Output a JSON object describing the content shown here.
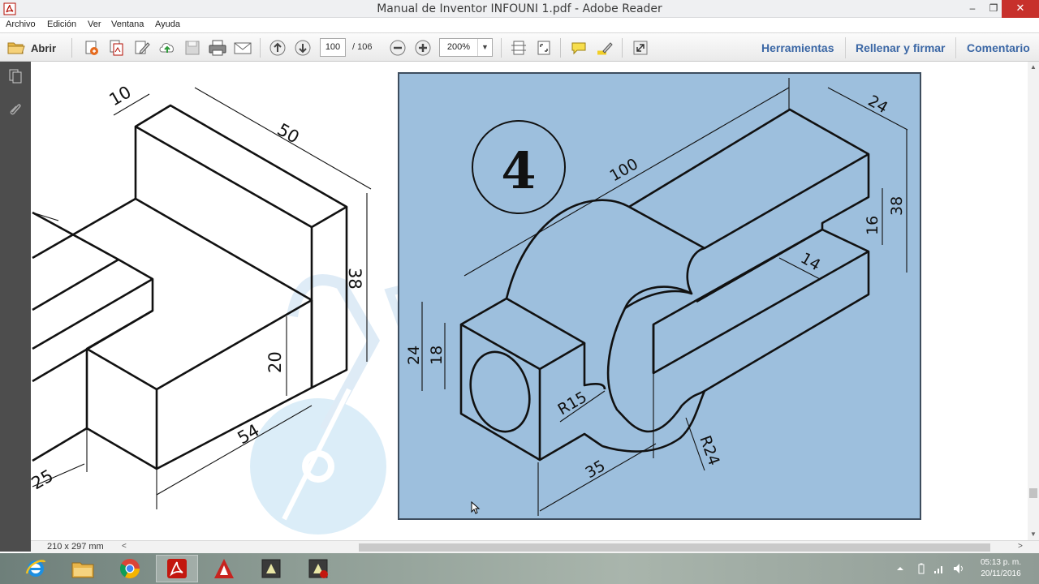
{
  "window": {
    "title": "Manual de Inventor INFOUNI 1.pdf - Adobe Reader",
    "minimize": "‒",
    "restore": "❐",
    "close": "✕"
  },
  "menu": [
    "Archivo",
    "Edición",
    "Ver",
    "Ventana",
    "Ayuda"
  ],
  "toolbar": {
    "open_label": "Abrir",
    "current_page": "100",
    "total_pages": "/ 106",
    "zoom": "200%",
    "zoom_arrow": "▼",
    "tools_label": "Herramientas",
    "fill_sign_label": "Rellenar y firmar",
    "comment_label": "Comentario"
  },
  "document": {
    "left_drawing_dims": [
      "10",
      "50",
      "38",
      "20",
      "54",
      "25"
    ],
    "right_drawing": {
      "badge": "4",
      "dims": [
        "100",
        "24",
        "38",
        "16",
        "14",
        "24",
        "18",
        "R15",
        "35",
        "R24"
      ],
      "panel_color": "#9dbfdd"
    }
  },
  "status": {
    "page_size": "210 x 297 mm"
  },
  "taskbar": {
    "apps": [
      "internet-explorer",
      "file-explorer",
      "chrome",
      "adobe-reader",
      "autocad",
      "inventor-1",
      "inventor-2"
    ],
    "clock_time": "05:13 p. m.",
    "clock_date": "20/11/2016"
  }
}
